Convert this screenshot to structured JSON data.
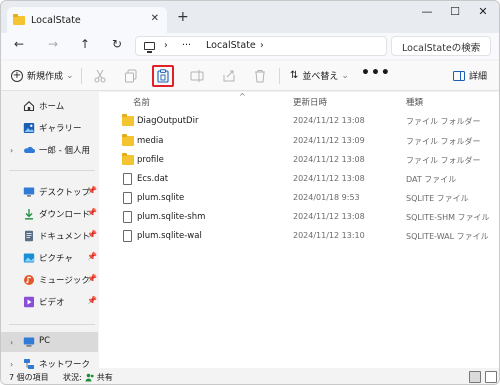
{
  "window": {
    "tab_title": "LocalState",
    "tab_close": "✕",
    "new_tab": "+",
    "minimize": "—",
    "maximize": "☐",
    "close": "✕"
  },
  "nav": {
    "back": "←",
    "forward": "→",
    "up": "↑",
    "refresh": "↻",
    "ellipsis": "···",
    "breadcrumb_sep": "›",
    "breadcrumb_current": "LocalState",
    "search_placeholder": "LocalStateの検索"
  },
  "toolbar": {
    "new_label": "新規作成",
    "sort_label": "並べ替え",
    "more_label": "•••",
    "details_label": "詳細"
  },
  "sidebar": {
    "items": [
      {
        "label": "ホーム",
        "icon": "home-icon"
      },
      {
        "label": "ギャラリー",
        "icon": "gallery-icon"
      },
      {
        "label": "一郎 - 個人用",
        "icon": "onedrive-icon",
        "chevron": "›"
      },
      {
        "label": "デスクトップ",
        "icon": "desktop-icon",
        "pinned": true
      },
      {
        "label": "ダウンロード",
        "icon": "download-icon",
        "pinned": true
      },
      {
        "label": "ドキュメント",
        "icon": "documents-icon",
        "pinned": true
      },
      {
        "label": "ピクチャ",
        "icon": "pictures-icon",
        "pinned": true
      },
      {
        "label": "ミュージック",
        "icon": "music-icon",
        "pinned": true
      },
      {
        "label": "ビデオ",
        "icon": "videos-icon",
        "pinned": true
      },
      {
        "label": "PC",
        "icon": "pc-icon",
        "chevron": "›",
        "selected": true
      },
      {
        "label": "ネットワーク",
        "icon": "network-icon",
        "chevron": "›"
      }
    ]
  },
  "file_list": {
    "columns": [
      "名前",
      "更新日時",
      "種類"
    ],
    "sort_indicator": "^",
    "rows": [
      {
        "name": "DiagOutputDir",
        "modified": "2024/11/12 13:08",
        "type": "ファイル フォルダー",
        "kind": "folder"
      },
      {
        "name": "media",
        "modified": "2024/11/12 13:09",
        "type": "ファイル フォルダー",
        "kind": "folder"
      },
      {
        "name": "profile",
        "modified": "2024/11/12 13:08",
        "type": "ファイル フォルダー",
        "kind": "folder"
      },
      {
        "name": "Ecs.dat",
        "modified": "2024/11/12 13:08",
        "type": "DAT ファイル",
        "kind": "file"
      },
      {
        "name": "plum.sqlite",
        "modified": "2024/01/18 9:53",
        "type": "SQLITE ファイル",
        "kind": "file"
      },
      {
        "name": "plum.sqlite-shm",
        "modified": "2024/11/12 13:08",
        "type": "SQLITE-SHM ファイル",
        "kind": "file"
      },
      {
        "name": "plum.sqlite-wal",
        "modified": "2024/11/12 13:10",
        "type": "SQLITE-WAL ファイル",
        "kind": "file"
      }
    ]
  },
  "status": {
    "item_count": "7 個の項目",
    "state_label": "状況:",
    "state_value": "共有"
  },
  "colors": {
    "highlight_box": "#e0202a",
    "folder": "#f4c430",
    "selected_bg": "#dadada",
    "onedrive": "#2f7bd6"
  }
}
